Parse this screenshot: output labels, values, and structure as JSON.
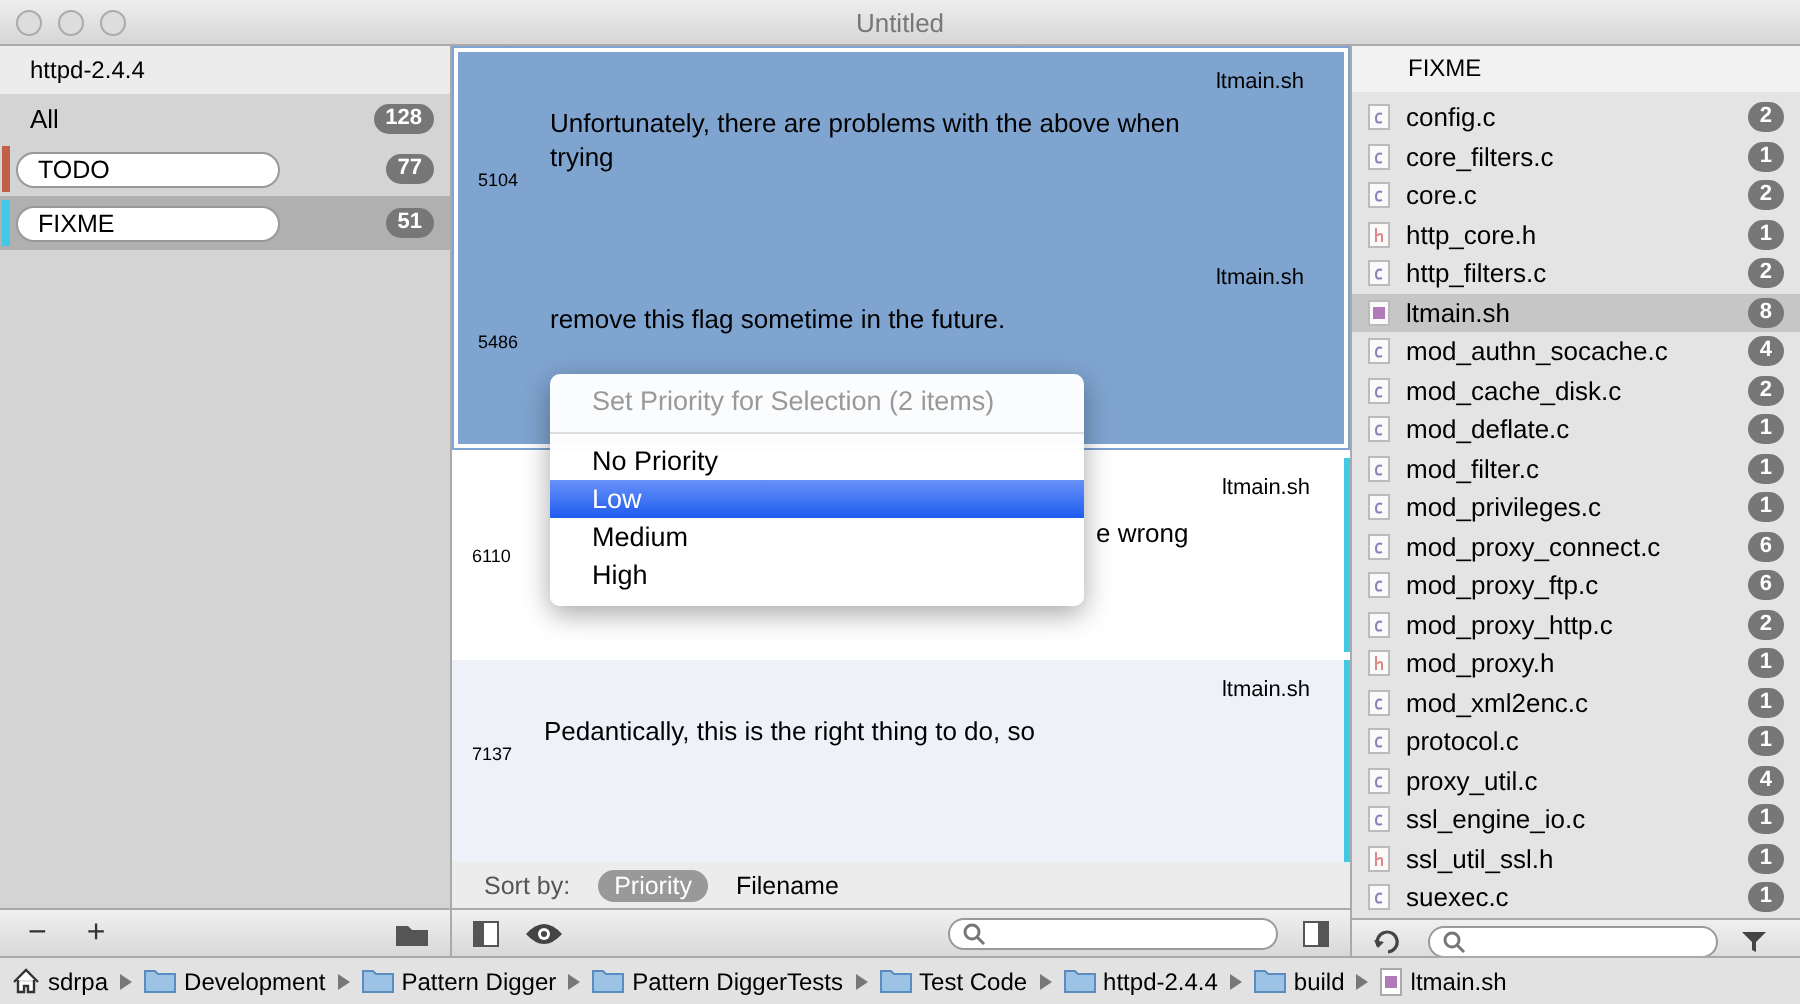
{
  "window": {
    "title": "Untitled"
  },
  "sidebar": {
    "project": "httpd-2.4.4",
    "items": [
      {
        "label": "All",
        "count": "128",
        "kind": "all",
        "selected": false
      },
      {
        "label": "TODO",
        "count": "77",
        "kind": "tag",
        "color": "#c0604a",
        "selected": false
      },
      {
        "label": "FIXME",
        "count": "51",
        "kind": "tag",
        "color": "#44c8e8",
        "selected": true
      }
    ],
    "buttons": [
      "−",
      "+"
    ]
  },
  "results": [
    {
      "line": "5104",
      "file": "ltmain.sh",
      "text": "Unfortunately, there are problems with the above when trying",
      "selected": true
    },
    {
      "line": "5486",
      "file": "ltmain.sh",
      "text": "remove this flag sometime in the future.",
      "selected": true
    },
    {
      "line": "6110",
      "file": "ltmain.sh",
      "text": "e wrong",
      "covered": true,
      "selected": false,
      "color": "#44c8e8"
    },
    {
      "line": "7137",
      "file": "ltmain.sh",
      "text": "Pedantically, this is the right thing to do, so",
      "selected": false,
      "color": "#44c8e8"
    }
  ],
  "context_menu": {
    "title": "Set Priority for Selection (2 items)",
    "items": [
      {
        "label": "No Priority",
        "selected": false
      },
      {
        "label": "Low",
        "selected": true
      },
      {
        "label": "Medium",
        "selected": false
      },
      {
        "label": "High",
        "selected": false
      }
    ]
  },
  "sort": {
    "label": "Sort by:",
    "options": [
      {
        "label": "Priority",
        "selected": true
      },
      {
        "label": "Filename",
        "selected": false
      }
    ]
  },
  "files": {
    "header": "FIXME",
    "items": [
      {
        "name": "config.c",
        "kind": "c",
        "count": "2",
        "selected": false
      },
      {
        "name": "core_filters.c",
        "kind": "c",
        "count": "1",
        "selected": false
      },
      {
        "name": "core.c",
        "kind": "c",
        "count": "2",
        "selected": false
      },
      {
        "name": "http_core.h",
        "kind": "h",
        "count": "1",
        "selected": false
      },
      {
        "name": "http_filters.c",
        "kind": "c",
        "count": "2",
        "selected": false
      },
      {
        "name": "ltmain.sh",
        "kind": "sh",
        "count": "8",
        "selected": true
      },
      {
        "name": "mod_authn_socache.c",
        "kind": "c",
        "count": "4",
        "selected": false
      },
      {
        "name": "mod_cache_disk.c",
        "kind": "c",
        "count": "2",
        "selected": false
      },
      {
        "name": "mod_deflate.c",
        "kind": "c",
        "count": "1",
        "selected": false
      },
      {
        "name": "mod_filter.c",
        "kind": "c",
        "count": "1",
        "selected": false
      },
      {
        "name": "mod_privileges.c",
        "kind": "c",
        "count": "1",
        "selected": false
      },
      {
        "name": "mod_proxy_connect.c",
        "kind": "c",
        "count": "6",
        "selected": false
      },
      {
        "name": "mod_proxy_ftp.c",
        "kind": "c",
        "count": "6",
        "selected": false
      },
      {
        "name": "mod_proxy_http.c",
        "kind": "c",
        "count": "2",
        "selected": false
      },
      {
        "name": "mod_proxy.h",
        "kind": "h",
        "count": "1",
        "selected": false
      },
      {
        "name": "mod_xml2enc.c",
        "kind": "c",
        "count": "1",
        "selected": false
      },
      {
        "name": "protocol.c",
        "kind": "c",
        "count": "1",
        "selected": false
      },
      {
        "name": "proxy_util.c",
        "kind": "c",
        "count": "4",
        "selected": false
      },
      {
        "name": "ssl_engine_io.c",
        "kind": "c",
        "count": "1",
        "selected": false
      },
      {
        "name": "ssl_util_ssl.h",
        "kind": "h",
        "count": "1",
        "selected": false
      },
      {
        "name": "suexec.c",
        "kind": "c",
        "count": "1",
        "selected": false
      }
    ]
  },
  "path_bar": [
    {
      "label": "sdrpa",
      "kind": "home"
    },
    {
      "label": "Development",
      "kind": "folder"
    },
    {
      "label": "Pattern Digger",
      "kind": "folder"
    },
    {
      "label": "Pattern DiggerTests",
      "kind": "folder"
    },
    {
      "label": "Test Code",
      "kind": "folder"
    },
    {
      "label": "httpd-2.4.4",
      "kind": "folder"
    },
    {
      "label": "build",
      "kind": "folder"
    },
    {
      "label": "ltmain.sh",
      "kind": "file"
    }
  ]
}
